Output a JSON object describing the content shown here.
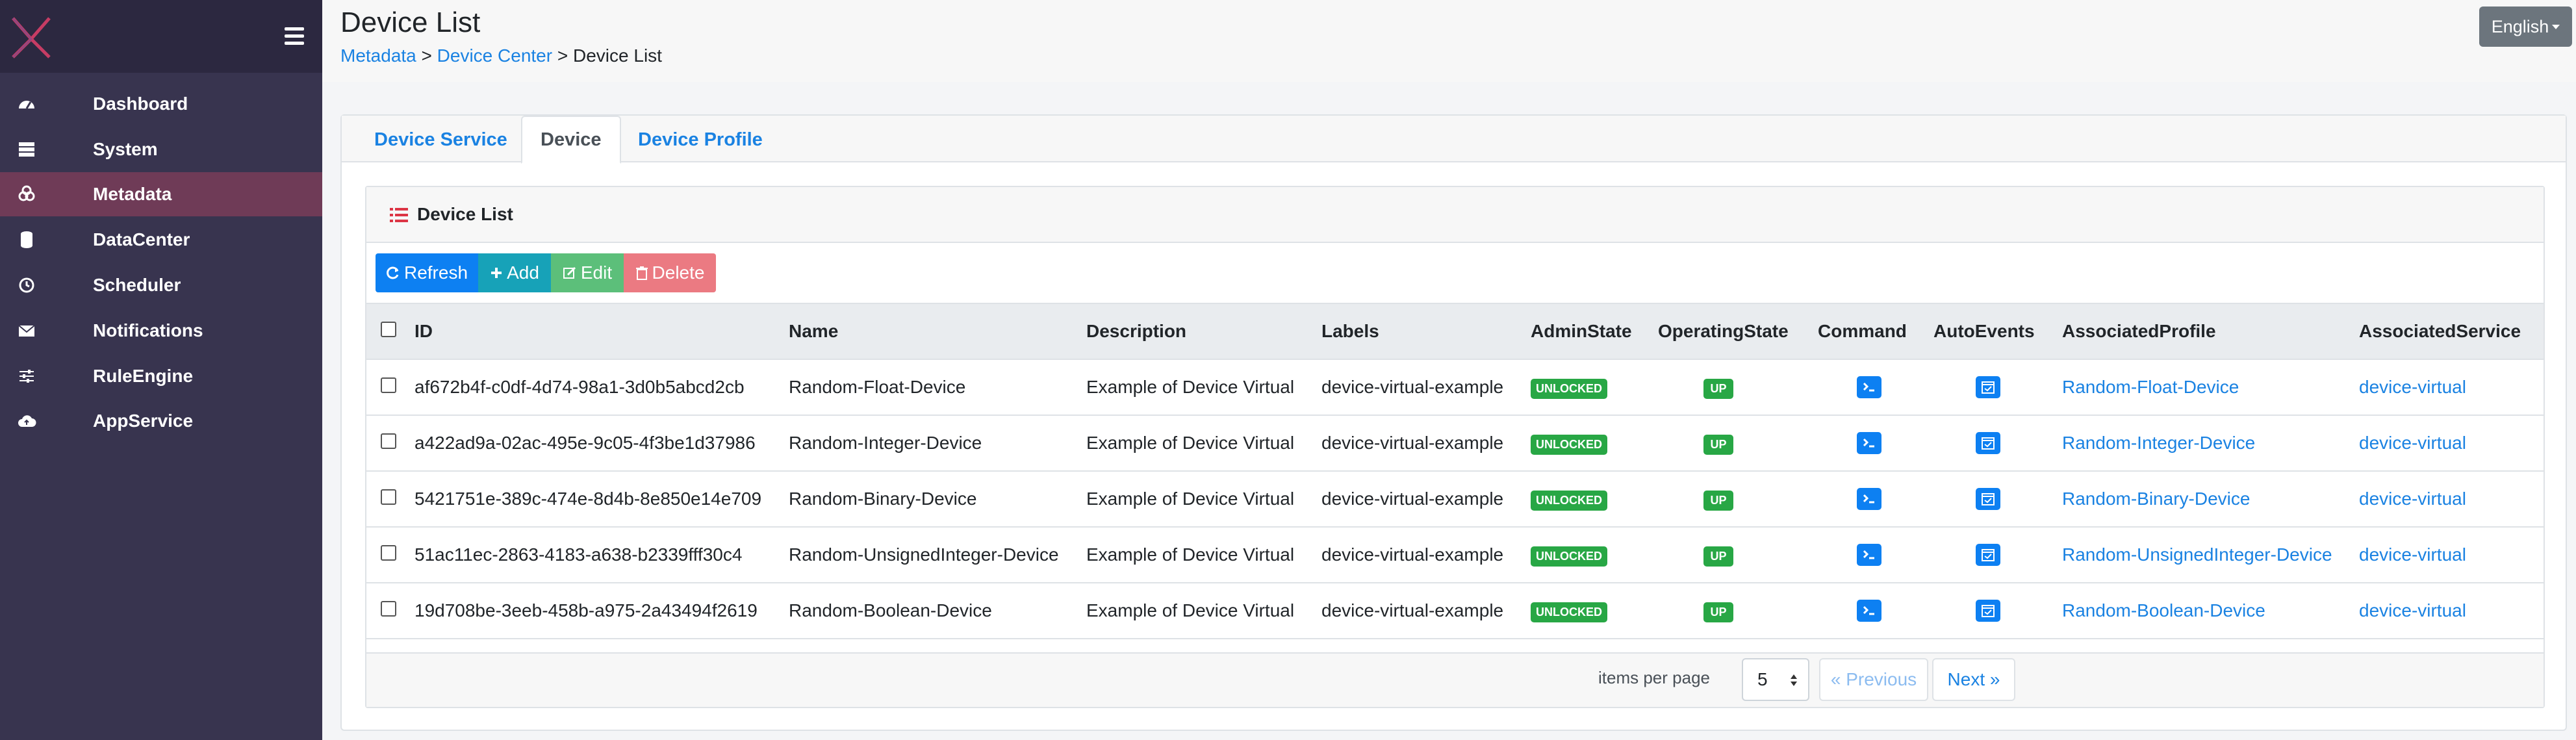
{
  "sidebar": {
    "items": [
      {
        "label": "Dashboard",
        "icon": "dashboard-icon"
      },
      {
        "label": "System",
        "icon": "server-icon"
      },
      {
        "label": "Metadata",
        "icon": "metadata-icon",
        "active": true
      },
      {
        "label": "DataCenter",
        "icon": "database-icon"
      },
      {
        "label": "Scheduler",
        "icon": "clock-icon"
      },
      {
        "label": "Notifications",
        "icon": "envelope-icon"
      },
      {
        "label": "RuleEngine",
        "icon": "sliders-icon"
      },
      {
        "label": "AppService",
        "icon": "cloud-upload-icon"
      }
    ]
  },
  "header": {
    "title": "Device List",
    "breadcrumb": {
      "item1": "Metadata",
      "sep": ">",
      "item2": "Device Center",
      "current": "Device List"
    },
    "language": "English"
  },
  "tabs": [
    {
      "label": "Device Service"
    },
    {
      "label": "Device",
      "active": true
    },
    {
      "label": "Device Profile"
    }
  ],
  "panel": {
    "title": "Device List",
    "buttons": {
      "refresh": "Refresh",
      "add": "Add",
      "edit": "Edit",
      "delete": "Delete"
    }
  },
  "table": {
    "columns": [
      "ID",
      "Name",
      "Description",
      "Labels",
      "AdminState",
      "OperatingState",
      "Command",
      "AutoEvents",
      "AssociatedProfile",
      "AssociatedService"
    ],
    "rows": [
      {
        "id": "af672b4f-c0df-4d74-98a1-3d0b5abcd2cb",
        "name": "Random-Float-Device",
        "description": "Example of Device Virtual",
        "labels": "device-virtual-example",
        "admin": "UNLOCKED",
        "operating": "UP",
        "profile": "Random-Float-Device",
        "service": "device-virtual"
      },
      {
        "id": "a422ad9a-02ac-495e-9c05-4f3be1d37986",
        "name": "Random-Integer-Device",
        "description": "Example of Device Virtual",
        "labels": "device-virtual-example",
        "admin": "UNLOCKED",
        "operating": "UP",
        "profile": "Random-Integer-Device",
        "service": "device-virtual"
      },
      {
        "id": "5421751e-389c-474e-8d4b-8e850e14e709",
        "name": "Random-Binary-Device",
        "description": "Example of Device Virtual",
        "labels": "device-virtual-example",
        "admin": "UNLOCKED",
        "operating": "UP",
        "profile": "Random-Binary-Device",
        "service": "device-virtual"
      },
      {
        "id": "51ac11ec-2863-4183-a638-b2339fff30c4",
        "name": "Random-UnsignedInteger-Device",
        "description": "Example of Device Virtual",
        "labels": "device-virtual-example",
        "admin": "UNLOCKED",
        "operating": "UP",
        "profile": "Random-UnsignedInteger-Device",
        "service": "device-virtual"
      },
      {
        "id": "19d708be-3eeb-458b-a975-2a43494f2619",
        "name": "Random-Boolean-Device",
        "description": "Example of Device Virtual",
        "labels": "device-virtual-example",
        "admin": "UNLOCKED",
        "operating": "UP",
        "profile": "Random-Boolean-Device",
        "service": "device-virtual"
      }
    ]
  },
  "pagination": {
    "items_per_page_label": "items per page",
    "items_per_page": "5",
    "previous": "Previous",
    "next": "Next"
  },
  "colors": {
    "sidebar_bg": "#38344f",
    "sidebar_active": "#6f3b57",
    "link": "#1a82e2",
    "badge_green": "#28a745"
  }
}
